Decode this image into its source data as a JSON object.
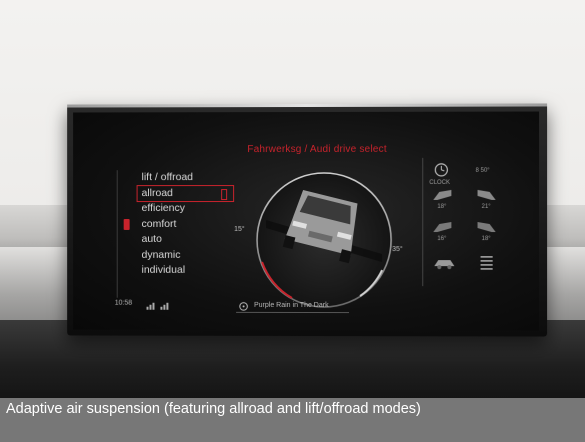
{
  "screen": {
    "title": "Fahrwerksg / Audi drive select",
    "menu": [
      {
        "label": "lift / offroad",
        "selected": false,
        "active": false
      },
      {
        "label": "allroad",
        "selected": true,
        "active": false
      },
      {
        "label": "efficiency",
        "selected": false,
        "active": false
      },
      {
        "label": "comfort",
        "selected": false,
        "active": true
      },
      {
        "label": "auto",
        "selected": false,
        "active": false
      },
      {
        "label": "dynamic",
        "selected": false,
        "active": false
      },
      {
        "label": "individual",
        "selected": false,
        "active": false
      }
    ],
    "gauge": {
      "left_label": "15°",
      "right_label": "35°"
    },
    "right_panel": {
      "top_left_label": "CLOCK",
      "top_right_value": "8 50°",
      "values": [
        "18°",
        "21°",
        "16°",
        "18°"
      ]
    },
    "status": {
      "time": "10:58",
      "now_playing": "Purple Rain in The Dark"
    }
  },
  "caption": "Adaptive air suspension (featuring allroad and lift/offroad modes)",
  "colors": {
    "accent": "#c8232c",
    "caption_bg": "#6e6e6e"
  }
}
